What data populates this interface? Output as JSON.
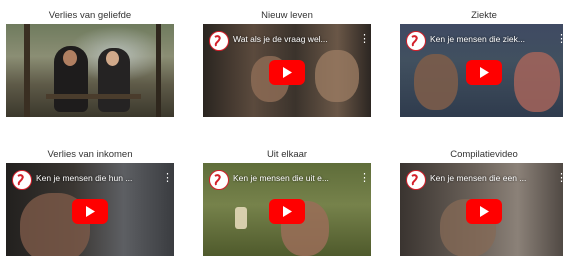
{
  "videos": [
    {
      "caption": "Verlies van geliefde",
      "title": "",
      "has_player_overlay": false
    },
    {
      "caption": "Nieuw leven",
      "title": "Wat als je de vraag wel...",
      "has_player_overlay": true
    },
    {
      "caption": "Ziekte",
      "title": "Ken je mensen die ziek...",
      "has_player_overlay": true
    },
    {
      "caption": "Verlies van inkomen",
      "title": "Ken je mensen die hun ...",
      "has_player_overlay": true
    },
    {
      "caption": "Uit elkaar",
      "title": "Ken je mensen die uit e...",
      "has_player_overlay": true
    },
    {
      "caption": "Compilatievideo",
      "title": "Ken je mensen die een ...",
      "has_player_overlay": true
    }
  ],
  "icons": {
    "channel": "channel-logo-icon",
    "menu": "more-vert-icon",
    "play": "youtube-play-icon"
  },
  "colors": {
    "play_button": "#ff0000",
    "logo_accent": "#d41f2a",
    "caption_text": "#333333"
  }
}
